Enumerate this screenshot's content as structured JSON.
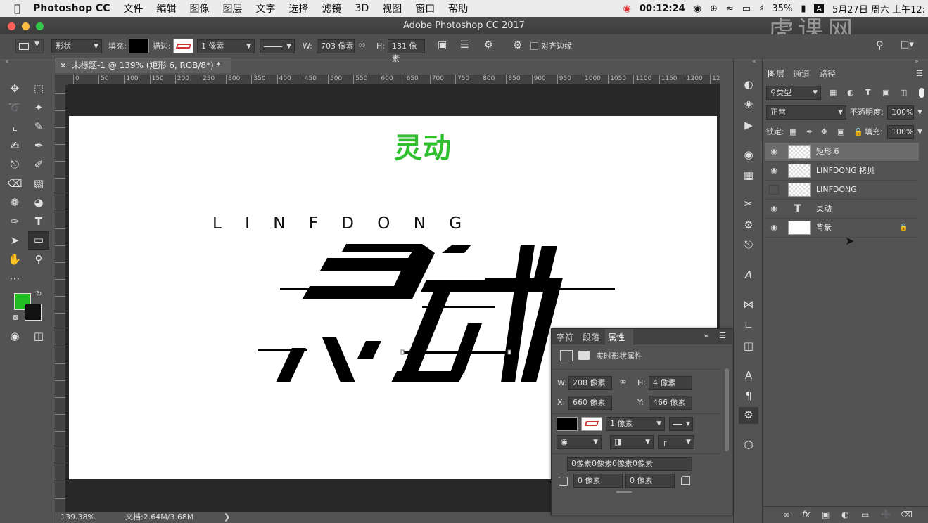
{
  "menubar": {
    "app": "Photoshop CC",
    "items": [
      "文件",
      "编辑",
      "图像",
      "图层",
      "文字",
      "选择",
      "滤镜",
      "3D",
      "视图",
      "窗口",
      "帮助"
    ],
    "clock": "00:12:24",
    "battery": "35%",
    "datetime": "5月27日 周六 上午12:"
  },
  "window": {
    "title": "Adobe Photoshop CC 2017",
    "watermark": "虎课网"
  },
  "options": {
    "tool_mode": "形状",
    "fill_label": "填充:",
    "stroke_label": "描边:",
    "stroke_width": "1 像素",
    "w_label": "W:",
    "w_value": "703 像素",
    "h_label": "H:",
    "h_value": "131 像素",
    "align_edges": "对齐边缘"
  },
  "document": {
    "tab": "未标题-1 @ 139% (矩形 6, RGB/8*) *",
    "ruler_ticks": [
      "0",
      "50",
      "100",
      "150",
      "200",
      "250",
      "300",
      "350",
      "400",
      "450",
      "500",
      "550",
      "600",
      "650",
      "700",
      "750",
      "800",
      "850",
      "900",
      "950",
      "1000",
      "1050",
      "1100",
      "1150",
      "1200",
      "1250"
    ],
    "zoom": "139.38%",
    "doc_size": "文档:2.64M/3.68M"
  },
  "artwork": {
    "green_title": "灵动",
    "letters": "L I N F D O N G",
    "green_color": "#2fbf2f"
  },
  "colors": {
    "foreground": "#22bb22",
    "background": "#111111",
    "accent": "#2fbf2f"
  },
  "layers_panel": {
    "tabs": [
      "图层",
      "通道",
      "路径"
    ],
    "filter": "类型",
    "blend_mode": "正常",
    "opacity_label": "不透明度:",
    "opacity": "100%",
    "lock_label": "锁定:",
    "fill_label": "填充:",
    "fill": "100%",
    "layers": [
      {
        "name": "矩形 6",
        "visible": true,
        "selected": true,
        "kind": "shape"
      },
      {
        "name": "LINFDONG 拷贝",
        "visible": true,
        "selected": false,
        "kind": "shape"
      },
      {
        "name": "LINFDONG",
        "visible": false,
        "selected": false,
        "kind": "shape"
      },
      {
        "name": "灵动",
        "visible": true,
        "selected": false,
        "kind": "text"
      },
      {
        "name": "背景",
        "visible": true,
        "selected": false,
        "kind": "background",
        "locked": true
      }
    ]
  },
  "properties_panel": {
    "tabs": [
      "字符",
      "段落",
      "属性"
    ],
    "heading": "实时形状属性",
    "w_label": "W:",
    "w": "208 像素",
    "h_label": "H:",
    "h": "4 像素",
    "x_label": "X:",
    "x": "660 像素",
    "y_label": "Y:",
    "y": "466 像素",
    "stroke_width": "1 像素",
    "corner_summary": "0像素0像素0像素0像素",
    "corner_a": "0 像素",
    "corner_b": "0 像素"
  }
}
